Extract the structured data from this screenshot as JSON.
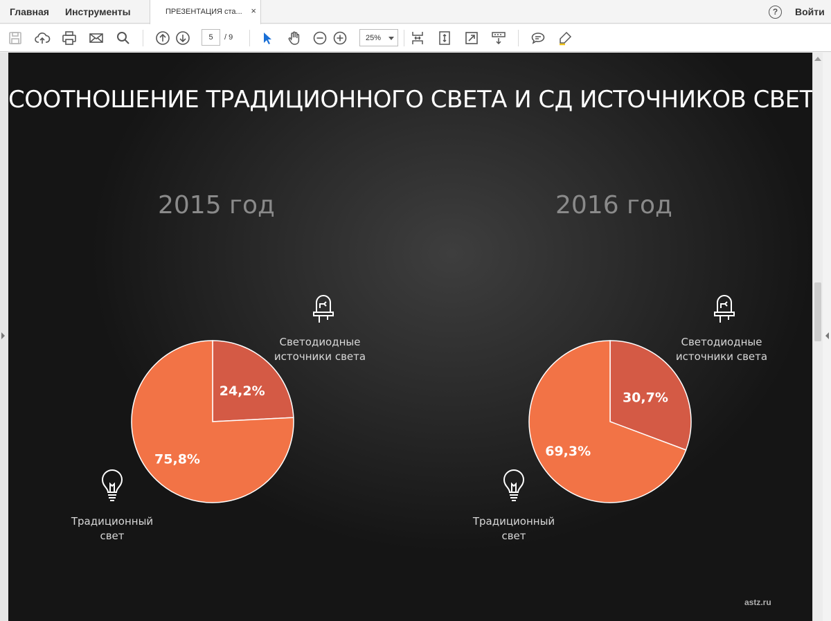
{
  "topbar": {
    "home": "Главная",
    "tools": "Инструменты",
    "doc_tab": "ПРЕЗЕНТАЦИЯ ста...",
    "close_glyph": "×",
    "help_glyph": "?",
    "signin": "Войти"
  },
  "toolbar": {
    "icons": [
      "save-icon",
      "upload-icon",
      "print-icon",
      "email-icon",
      "search-icon",
      "page-up-icon",
      "page-down-icon",
      "select-arrow-icon",
      "hand-icon",
      "zoom-out-icon",
      "zoom-in-icon",
      "fit-page-icon",
      "scroll-mode-icon",
      "fullscreen-icon",
      "read-mode-icon",
      "comment-icon",
      "highlight-icon"
    ],
    "page_current": "5",
    "page_total": "/ 9",
    "zoom_value": "25%",
    "accent_color": "#1a6fd6"
  },
  "slide": {
    "title": "СООТНОШЕНИЕ ТРАДИЦИОННОГО СВЕТА И СД ИСТОЧНИКОВ СВЕТА",
    "watermark": "astz.ru",
    "pies": [
      {
        "year": "2015 год",
        "led_caption": "Светодиодные\nисточники света",
        "traditional_caption": "Традиционный\nсвет",
        "led_label": "24,2%",
        "traditional_label": "75,8%"
      },
      {
        "year": "2016 год",
        "led_caption": "Светодиодные\nисточники света",
        "traditional_caption": "Традиционный\nсвет",
        "led_label": "30,7%",
        "traditional_label": "69,3%"
      }
    ],
    "colors": {
      "led": "#d45a45",
      "traditional": "#f27346",
      "edge": "#ffffff"
    }
  },
  "chart_data": [
    {
      "type": "pie",
      "title": "2015 год",
      "categories": [
        "Светодиодные источники света",
        "Традиционный свет"
      ],
      "values": [
        24.2,
        75.8
      ],
      "colors": [
        "#d45a45",
        "#f27346"
      ]
    },
    {
      "type": "pie",
      "title": "2016 год",
      "categories": [
        "Светодиодные источники света",
        "Традиционный свет"
      ],
      "values": [
        30.7,
        69.3
      ],
      "colors": [
        "#d45a45",
        "#f27346"
      ]
    }
  ]
}
